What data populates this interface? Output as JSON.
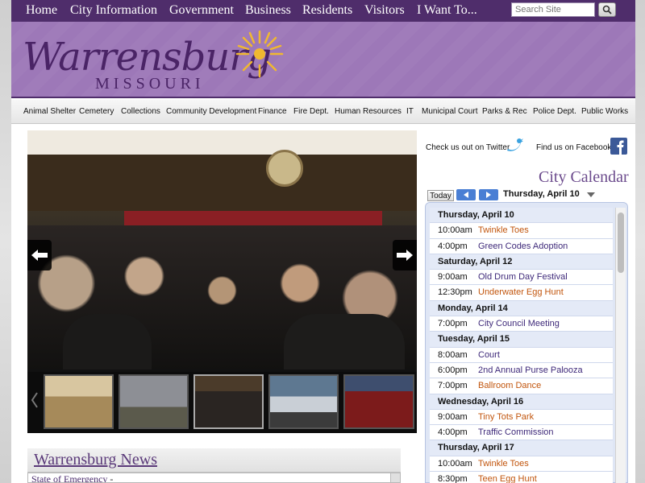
{
  "topnav": {
    "items": [
      "Home",
      "City Information",
      "Government",
      "Business",
      "Residents",
      "Visitors",
      "I Want To..."
    ],
    "search_placeholder": "Search Site"
  },
  "banner": {
    "logo_word": "Warrensburg",
    "logo_sub": "MISSOURI"
  },
  "deptnav": {
    "items": [
      "Animal Shelter",
      "Cemetery",
      "Collections",
      "Community Development",
      "Finance",
      "Fire Dept.",
      "Human Resources",
      "IT",
      "Municipal Court",
      "Parks & Rec",
      "Police Dept.",
      "Public Works"
    ]
  },
  "social": {
    "twitter": "Check us out on Twitter",
    "facebook": "Find us on Facebook"
  },
  "calendar": {
    "title": "City Calendar",
    "today_label": "Today",
    "current_date": "Thursday, April 10",
    "days": [
      {
        "day": "Thursday, April 10",
        "events": [
          {
            "time": "10:00am",
            "title": "Twinkle Toes",
            "color": "#c2560e"
          },
          {
            "time": "4:00pm",
            "title": "Green Codes Adoption",
            "color": "#3f2a7a"
          }
        ]
      },
      {
        "day": "Saturday, April 12",
        "events": [
          {
            "time": "9:00am",
            "title": "Old Drum Day Festival",
            "color": "#3f2a7a"
          },
          {
            "time": "12:30pm",
            "title": "Underwater Egg Hunt",
            "color": "#c2560e"
          }
        ]
      },
      {
        "day": "Monday, April 14",
        "events": [
          {
            "time": "7:00pm",
            "title": "City Council Meeting",
            "color": "#3f2a7a"
          }
        ]
      },
      {
        "day": "Tuesday, April 15",
        "events": [
          {
            "time": "8:00am",
            "title": "Court",
            "color": "#3f2a7a"
          },
          {
            "time": "6:00pm",
            "title": "2nd Annual Purse Palooza",
            "color": "#3f2a7a"
          },
          {
            "time": "7:00pm",
            "title": "Ballroom Dance",
            "color": "#c2560e"
          }
        ]
      },
      {
        "day": "Wednesday, April 16",
        "events": [
          {
            "time": "9:00am",
            "title": "Tiny Tots Park",
            "color": "#c2560e"
          },
          {
            "time": "4:00pm",
            "title": "Traffic Commission",
            "color": "#3f2a7a"
          }
        ]
      },
      {
        "day": "Thursday, April 17",
        "events": [
          {
            "time": "10:00am",
            "title": "Twinkle Toes",
            "color": "#c2560e"
          },
          {
            "time": "8:30pm",
            "title": "Teen Egg Hunt",
            "color": "#c2560e"
          }
        ]
      }
    ]
  },
  "news": {
    "title": "Warrensburg News",
    "first_item": "State of Emergency",
    "first_item_suffix": " -"
  },
  "colors": {
    "brand_purple": "#4f2d6b",
    "banner_purple": "#9d78b8",
    "calendar_blue": "#4a7fd4",
    "orange_event": "#c2560e",
    "purple_event": "#3f2a7a"
  }
}
